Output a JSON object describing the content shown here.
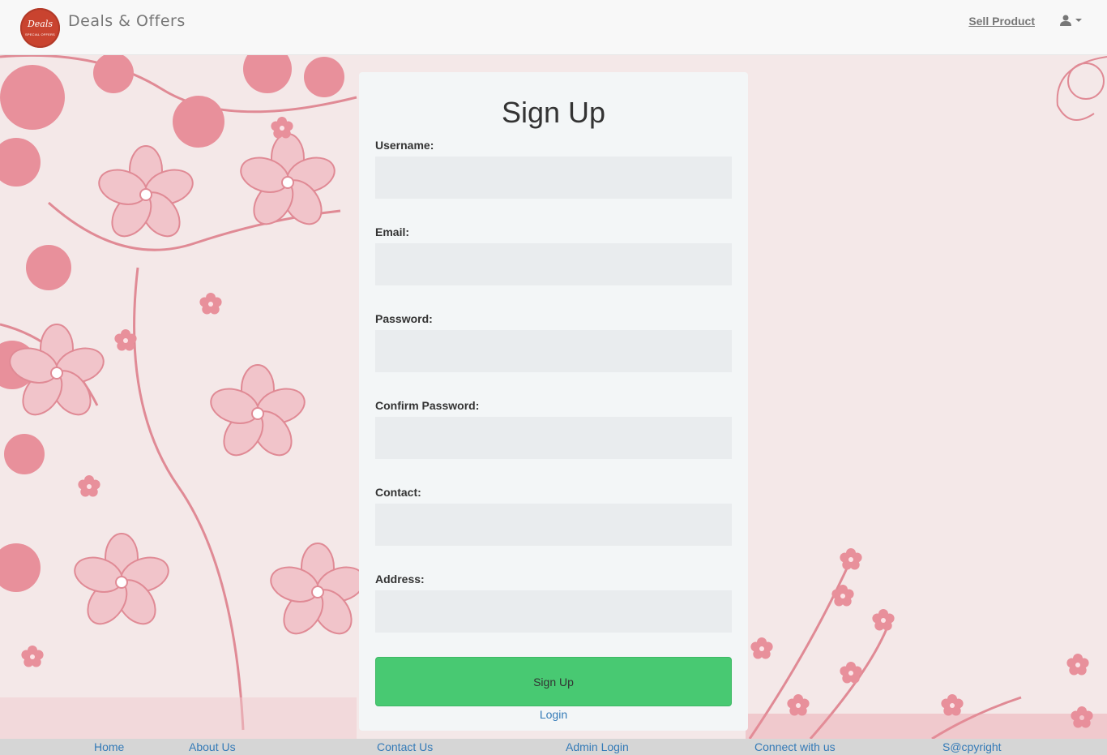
{
  "navbar": {
    "logo_text": "Deals",
    "logo_subtext": "SPECIAL OFFERS",
    "brand": "Deals & Offers",
    "sell_product": "Sell Product",
    "user_icon": "user-icon"
  },
  "form": {
    "title": "Sign Up",
    "fields": [
      {
        "label": "Username:",
        "value": "",
        "placeholder": ""
      },
      {
        "label": "Email:",
        "value": "",
        "placeholder": ""
      },
      {
        "label": "Password:",
        "value": "",
        "placeholder": ""
      },
      {
        "label": "Confirm Password:",
        "value": "",
        "placeholder": ""
      },
      {
        "label": "Contact:",
        "value": "",
        "placeholder": ""
      },
      {
        "label": "Address:",
        "value": "",
        "placeholder": ""
      }
    ],
    "submit_label": "Sign Up",
    "login_link": "Login"
  },
  "footer": {
    "links": [
      "Home",
      "About Us",
      "Contact Us",
      "Admin Login",
      "Connect with us",
      "S@cpyright"
    ]
  },
  "colors": {
    "accent_green": "#48c972",
    "link_blue": "#337ab7",
    "floral_pink": "#e08a95",
    "background": "#f4e8e8"
  }
}
